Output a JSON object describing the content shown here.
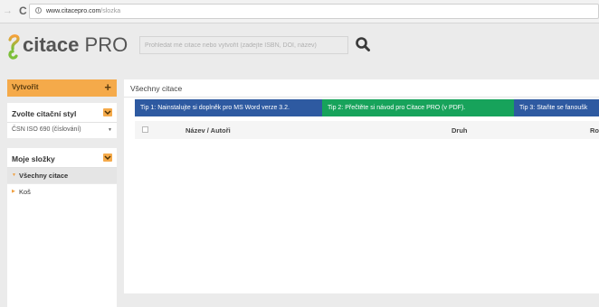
{
  "browser": {
    "url_host": "www.citacepro.com",
    "url_path": "/slozka"
  },
  "header": {
    "logo_text_strong": "citace",
    "logo_text_light": "PRO",
    "search_placeholder": "Prohledat mé citace nebo vytvořit (zadejte ISBN, DOI, název)"
  },
  "sidebar": {
    "create_label": "Vytvořit",
    "style_section_label": "Zvolte citační styl",
    "style_selected": "ČSN ISO 690 (číslování)",
    "folders_section_label": "Moje složky",
    "folders": [
      {
        "label": "Všechny citace"
      },
      {
        "label": "Koš"
      }
    ]
  },
  "main": {
    "title": "Všechny citace",
    "tips": [
      {
        "label": "Tip 1: Nainstalujte si doplněk pro MS Word verze 3.2."
      },
      {
        "label": "Tip 2: Přečtěte si návod pro Citace PRO (v PDF)."
      },
      {
        "label": "Tip 3: Staňte se fanoušk"
      }
    ],
    "columns": [
      "Název / Autoři",
      "Druh",
      "Ro"
    ]
  },
  "colors": {
    "accent_orange": "#f5aa4a",
    "tip_blue": "#2e5aa1",
    "tip_green": "#17a35b",
    "logo_gradient_top": "#f6a13a",
    "logo_gradient_bottom": "#7cbf3a"
  }
}
